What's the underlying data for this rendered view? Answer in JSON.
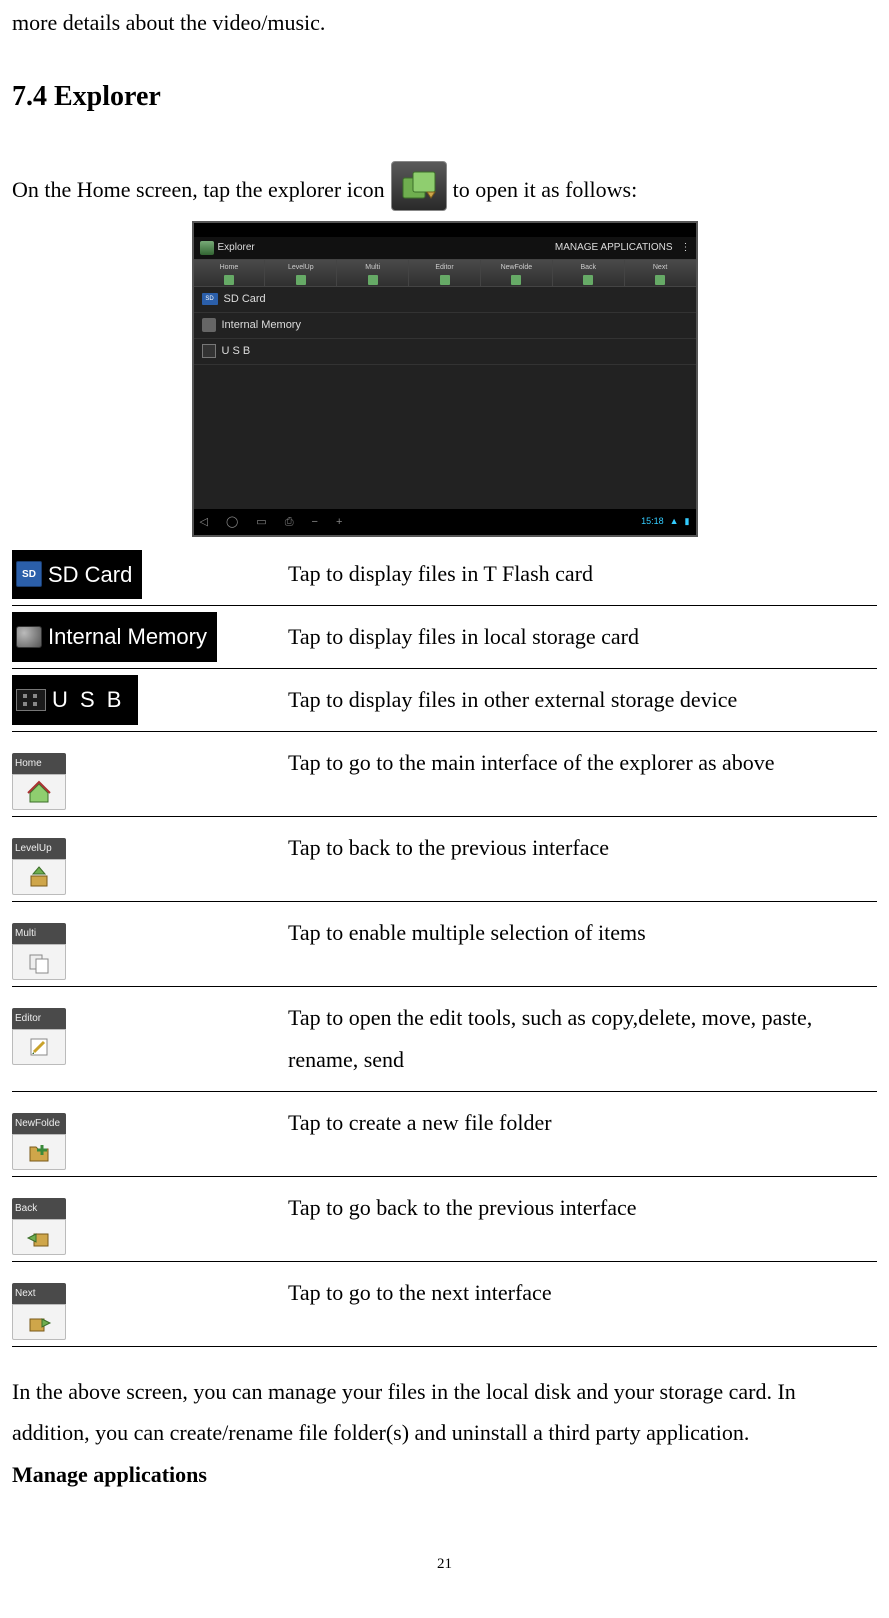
{
  "top_fragment": "more details about the video/music.",
  "heading": "7.4 Explorer",
  "intro_before": "On the Home screen, tap the explorer icon",
  "intro_after": " to open it as follows:",
  "screenshot": {
    "title_app": "Explorer",
    "manage_label": "MANAGE APPLICATIONS",
    "toolbar": [
      "Home",
      "LevelUp",
      "Multi",
      "Editor",
      "NewFolde",
      "Back",
      "Next"
    ],
    "rows": [
      {
        "kind": "sd",
        "label": "SD Card"
      },
      {
        "kind": "im",
        "label": "Internal Memory"
      },
      {
        "kind": "usb",
        "label": "U S B"
      }
    ],
    "clock": "15:18"
  },
  "table": [
    {
      "icon": "sd",
      "label": "SD Card",
      "desc": "Tap to display files in T Flash card"
    },
    {
      "icon": "im",
      "label": "Internal Memory",
      "desc": "Tap to display files in local storage card"
    },
    {
      "icon": "usb",
      "label": "U S B",
      "desc": "Tap to display files in other external storage device"
    },
    {
      "icon": "home",
      "cap": "Home",
      "desc": "Tap to go to the main interface of the explorer as above"
    },
    {
      "icon": "levelup",
      "cap": "LevelUp",
      "desc": "Tap to back to the previous interface"
    },
    {
      "icon": "multi",
      "cap": "Multi",
      "desc": "Tap to enable multiple selection of items"
    },
    {
      "icon": "editor",
      "cap": "Editor",
      "desc": "Tap to open the edit tools, such as copy,delete, move, paste, rename, send",
      "justify": true
    },
    {
      "icon": "newfolder",
      "cap": "NewFolde",
      "desc": "Tap to create a new file folder"
    },
    {
      "icon": "backnav",
      "cap": "Back",
      "desc": "Tap to go back to the previous interface"
    },
    {
      "icon": "nextnav",
      "cap": "Next",
      "desc": "Tap to go to the next interface"
    }
  ],
  "closing": {
    "p1": "In the above screen, you can manage your files in the local disk and your storage card. In addition, you can create/rename file folder(s) and uninstall a third party application.",
    "p2": "Manage applications"
  },
  "page_number": "21"
}
